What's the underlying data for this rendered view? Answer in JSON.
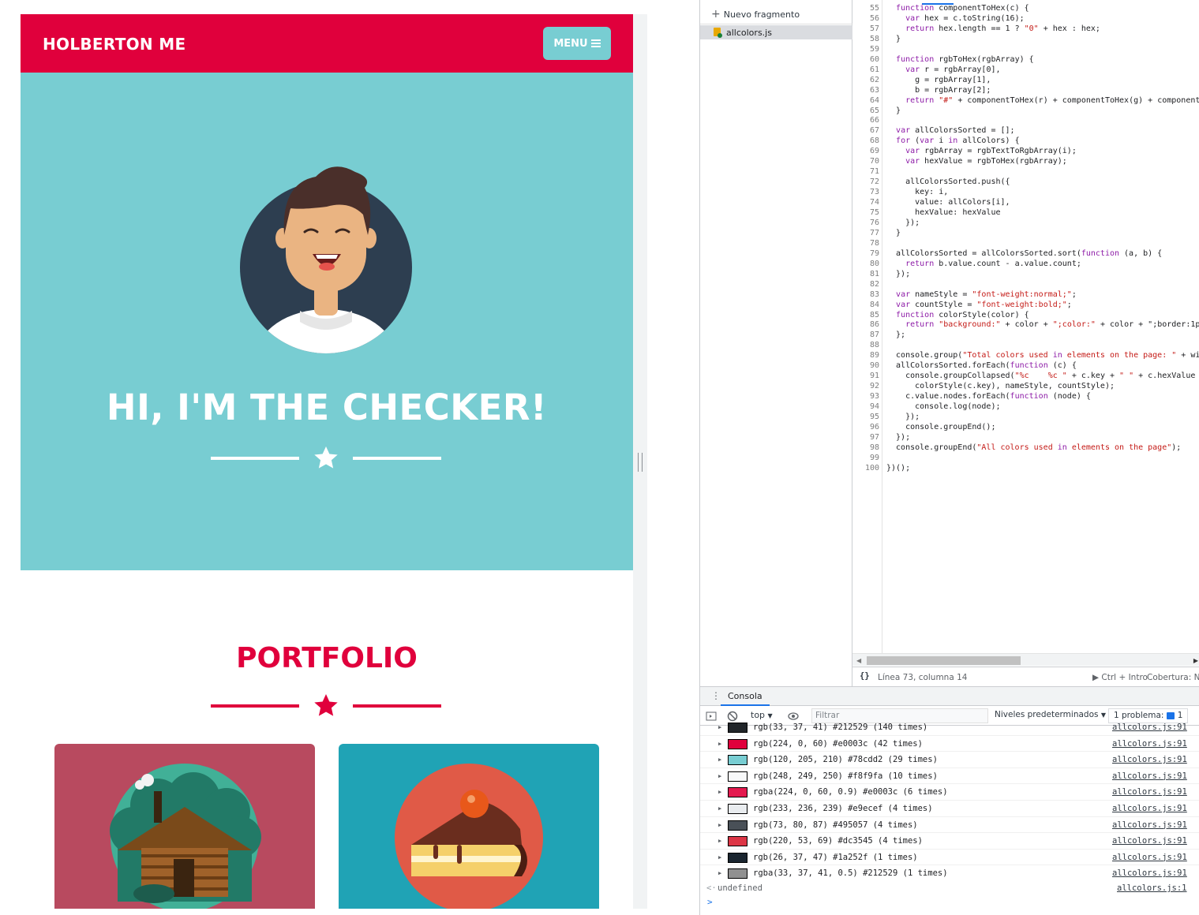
{
  "page": {
    "brand": "HOLBERTON ME",
    "menu_label": "MENU",
    "hero_title": "HI, I'M THE CHECKER!",
    "portfolio_title": "PORTFOLIO",
    "colors": {
      "primary": "#e0003c",
      "hero_bg": "#78cdd2",
      "menu_bg": "#78cdd2",
      "white": "#ffffff",
      "avatar_circle": "#2d3e50",
      "card_cabin_bg": "#b84a5f",
      "card_cake_bg": "#20a3b5"
    },
    "cards": [
      {
        "name": "cabin",
        "icon": "log-cabin-icon"
      },
      {
        "name": "cake",
        "icon": "cake-slice-icon"
      }
    ]
  },
  "devtools": {
    "new_snippet_label": "Nuevo fragmento",
    "snippet_file": "allcolors.js",
    "status_position": "Línea 73, columna 14",
    "status_run": "Ctrl + Intro",
    "status_coverage": "Cobertura: N",
    "drawer_tab": "Consola",
    "context": "top",
    "filter_placeholder": "Filtrar",
    "levels": "Niveles predeterminados",
    "issues": "1 problema:",
    "issues_count": "1",
    "code_first_line": 55,
    "code_lines": [
      "  function componentToHex(c) {",
      "    var hex = c.toString(16);",
      "    return hex.length == 1 ? \"0\" + hex : hex;",
      "  }",
      "",
      "  function rgbToHex(rgbArray) {",
      "    var r = rgbArray[0],",
      "      g = rgbArray[1],",
      "      b = rgbArray[2];",
      "    return \"#\" + componentToHex(r) + componentToHex(g) + componentT",
      "  }",
      "",
      "  var allColorsSorted = [];",
      "  for (var i in allColors) {",
      "    var rgbArray = rgbTextToRgbArray(i);",
      "    var hexValue = rgbToHex(rgbArray);",
      "",
      "    allColorsSorted.push({",
      "      key: i,",
      "      value: allColors[i],",
      "      hexValue: hexValue",
      "    });",
      "  }",
      "",
      "  allColorsSorted = allColorsSorted.sort(function (a, b) {",
      "    return b.value.count - a.value.count;",
      "  });",
      "",
      "  var nameStyle = \"font-weight:normal;\";",
      "  var countStyle = \"font-weight:bold;\";",
      "  function colorStyle(color) {",
      "    return \"background:\" + color + \";color:\" + color + \";border:1px",
      "  };",
      "",
      "  console.group(\"Total colors used in elements on the page: \" + win",
      "  allColorsSorted.forEach(function (c) {",
      "    console.groupCollapsed(\"%c    %c \" + c.key + \" \" + c.hexValue +",
      "      colorStyle(c.key), nameStyle, countStyle);",
      "    c.value.nodes.forEach(function (node) {",
      "      console.log(node);",
      "    });",
      "    console.groupEnd();",
      "  });",
      "  console.groupEnd(\"All colors used in elements on the page\");",
      "",
      "})();"
    ],
    "console_rows": [
      {
        "swatch": "#212529",
        "text": "rgb(33, 37, 41) #212529 (140 times)",
        "src": "allcolors.js:91"
      },
      {
        "swatch": "#e0003c",
        "text": "rgb(224, 0, 60) #e0003c (42 times)",
        "src": "allcolors.js:91"
      },
      {
        "swatch": "#78cdd2",
        "text": "rgb(120, 205, 210) #78cdd2 (29 times)",
        "src": "allcolors.js:91"
      },
      {
        "swatch": "#f8f9fa",
        "text": "rgb(248, 249, 250) #f8f9fa (10 times)",
        "src": "allcolors.js:91"
      },
      {
        "swatch": "#e41a4f",
        "text": "rgba(224, 0, 60, 0.9) #e0003c (6 times)",
        "src": "allcolors.js:91"
      },
      {
        "swatch": "#e9ecef",
        "text": "rgb(233, 236, 239) #e9ecef (4 times)",
        "src": "allcolors.js:91"
      },
      {
        "swatch": "#495057",
        "text": "rgb(73, 80, 87) #495057 (4 times)",
        "src": "allcolors.js:91"
      },
      {
        "swatch": "#dc3545",
        "text": "rgb(220, 53, 69) #dc3545 (4 times)",
        "src": "allcolors.js:91"
      },
      {
        "swatch": "#1a252f",
        "text": "rgb(26, 37, 47) #1a252f (1 times)",
        "src": "allcolors.js:91"
      },
      {
        "swatch": "#909090",
        "text": "rgba(33, 37, 41, 0.5) #212529 (1 times)",
        "src": "allcolors.js:91"
      }
    ],
    "result_value": "undefined",
    "result_src": "allcolors.js:1"
  }
}
